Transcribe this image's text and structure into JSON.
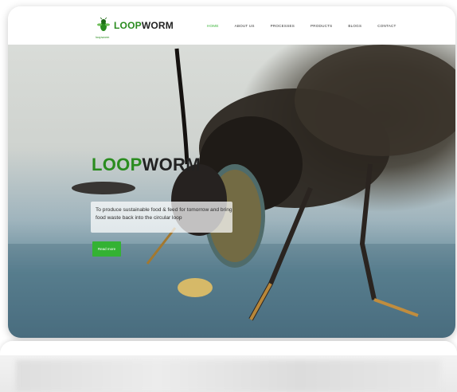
{
  "brand": {
    "logo_part1": "LOOP",
    "logo_part2": "WORM",
    "logo_sub": "loopworm"
  },
  "nav": {
    "items": [
      "HOME",
      "ABOUT US",
      "PROCESSES",
      "PRODUCTS",
      "BLOGS",
      "CONTACT"
    ],
    "active_index": 0
  },
  "hero": {
    "title_part1": "LOOP",
    "title_part2": "WORM",
    "tagline": "To produce sustainable food & feed for tomorrow and bring food waste back into the circular loop",
    "cta_label": "Read more"
  },
  "colors": {
    "brand_green": "#2a8c1f",
    "accent_green": "#34b233"
  }
}
